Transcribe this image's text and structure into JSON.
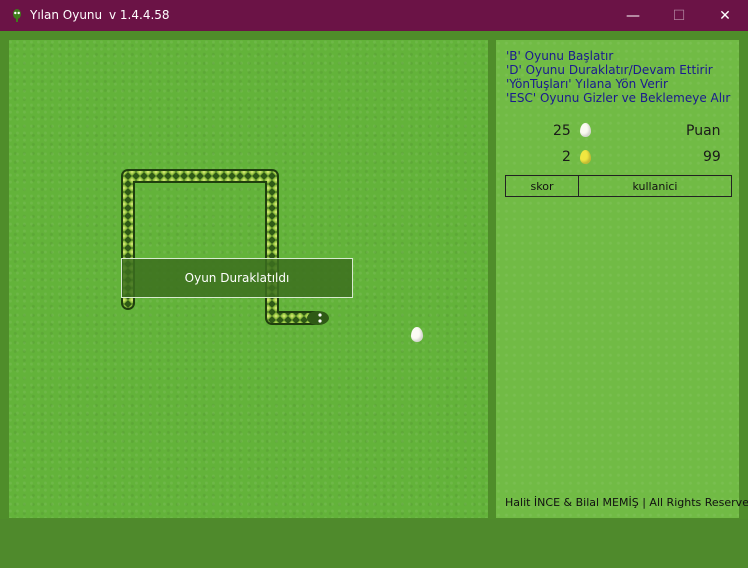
{
  "window": {
    "title": "Yılan Oyunu",
    "version": "v 1.4.4.58",
    "minimize_glyph": "—",
    "maximize_glyph": "☐",
    "close_glyph": "✕"
  },
  "help": {
    "line1": "'B' Oyunu Başlatır",
    "line2": "'D' Oyunu Duraklatır/Devam Ettirir",
    "line3": "'YönTuşları' Yılana Yön Verir",
    "line4": "'ESC' Oyunu Gizler ve Beklemeye Alır"
  },
  "stats": {
    "white_egg_count": "25",
    "gold_egg_count": "2",
    "score_label": "Puan",
    "score_value": "99"
  },
  "score_table": {
    "col1": "skor",
    "col2": "kullanici"
  },
  "game": {
    "pause_message": "Oyun Duraklatıldı"
  },
  "footer": "Halit İNCE & Bilal MEMİŞ |  All Rights Reserved",
  "colors": {
    "titlebar": "#6b1346",
    "field": "#63b33a",
    "panel": "#71bb45",
    "help_text": "#1a1a90",
    "snake": "#2f5a16"
  },
  "icons": {
    "app": "snake-head-icon",
    "white_egg": "white-egg-icon",
    "gold_egg": "gold-egg-icon"
  }
}
